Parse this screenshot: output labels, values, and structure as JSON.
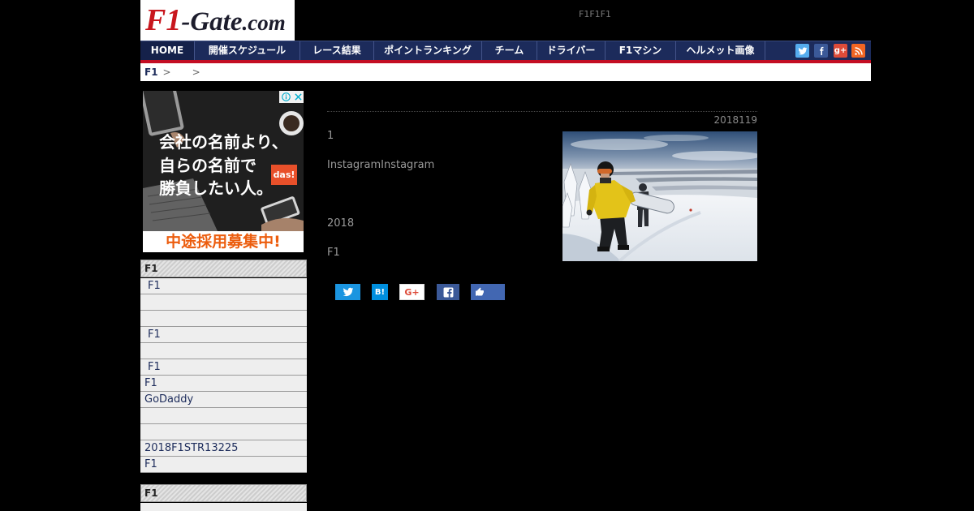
{
  "header": {
    "logo": {
      "f1": "F1",
      "gate": "-Gate",
      "com": ".com"
    },
    "tagline": "F1F1F1"
  },
  "nav": {
    "items": [
      "HOME",
      "開催スケジュール",
      "レース結果",
      "ポイントランキング",
      "チーム",
      "ドライバー",
      "F1マシン",
      "ヘルメット画像"
    ],
    "social": [
      {
        "icon": "twitter-icon"
      },
      {
        "icon": "facebook-icon"
      },
      {
        "icon": "google-plus-icon",
        "glyph": "g+"
      },
      {
        "icon": "rss-icon"
      }
    ]
  },
  "breadcrumb": {
    "home": "F1",
    "separator": ">"
  },
  "ad": {
    "headline": [
      "会社の名前より、",
      "自らの名前で",
      "勝負したい人。"
    ],
    "brand": "das!",
    "cta": "中途採用募集中!",
    "icons": [
      "adchoices-info-icon",
      "adchoices-close-icon"
    ]
  },
  "sidebar": {
    "sections": [
      {
        "heading": "F1",
        "items": [
          "F1",
          "",
          "",
          "F1",
          "",
          "F1",
          "F1",
          "GoDaddy",
          "",
          "",
          "2018F1STR13225",
          "F1"
        ]
      },
      {
        "heading": "F1",
        "items": [
          ""
        ]
      }
    ]
  },
  "article": {
    "date": "2018119",
    "paragraphs": [
      "1",
      "InstagramInstagram",
      "",
      "2018",
      "F1"
    ],
    "share": {
      "twitter_icon": "twitter-icon",
      "hatena_label": "B!",
      "gplus_label": "G+",
      "facebook_icon": "facebook-icon",
      "like_icon": "thumbs-up-icon"
    }
  },
  "colors": {
    "page_background": "#000000",
    "accent_red": "#c30d23",
    "nav_background": "#1c2b5b",
    "link_navy": "#1d2c5b",
    "twitter": "#1b95e0",
    "facebook": "#3b5998",
    "google_plus": "#dd4b39",
    "rss": "#f26522",
    "hatena": "#008fde"
  }
}
